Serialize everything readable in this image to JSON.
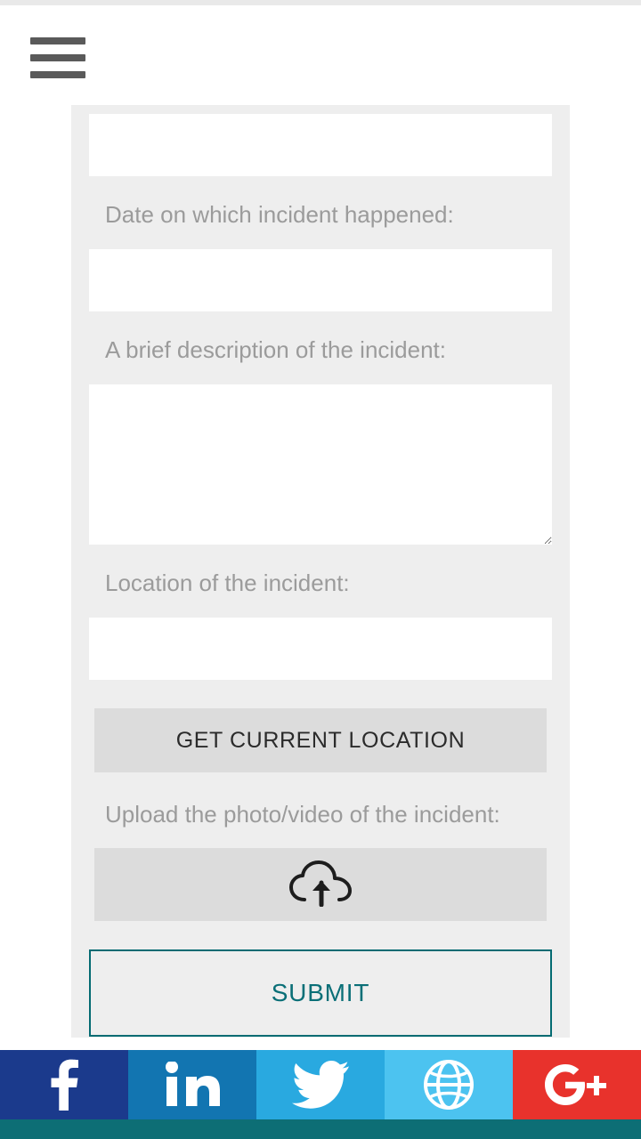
{
  "header": {
    "menu_icon": "hamburger-menu-icon"
  },
  "form": {
    "fields": [
      {
        "label": "",
        "value": "",
        "type": "text"
      },
      {
        "label": "Date on which incident happened:",
        "value": "",
        "type": "text"
      },
      {
        "label": "A brief description of the incident:",
        "value": "",
        "type": "textarea"
      },
      {
        "label": "Location of the incident:",
        "value": "",
        "type": "text"
      }
    ],
    "labels": {
      "date": "Date on which incident happened:",
      "description": "A brief description of the incident:",
      "location": "Location of the incident:",
      "upload": "Upload the photo/video of the incident:"
    },
    "buttons": {
      "get_location": "GET CURRENT LOCATION",
      "upload_icon": "cloud-upload-icon",
      "submit": "SUBMIT"
    }
  },
  "social": [
    {
      "name": "facebook",
      "icon": "facebook-icon",
      "color": "#1b3a8c"
    },
    {
      "name": "linkedin",
      "icon": "linkedin-icon",
      "color": "#1275b1"
    },
    {
      "name": "twitter",
      "icon": "twitter-icon",
      "color": "#29a9e0"
    },
    {
      "name": "website",
      "icon": "globe-icon",
      "color": "#4cc3f0"
    },
    {
      "name": "googleplus",
      "icon": "google-plus-icon",
      "color": "#e8322c"
    }
  ],
  "colors": {
    "accent": "#0a6f77",
    "card_bg": "#eeeeee",
    "button_bg": "#dcdcdc",
    "label_text": "#9b9b9b"
  }
}
